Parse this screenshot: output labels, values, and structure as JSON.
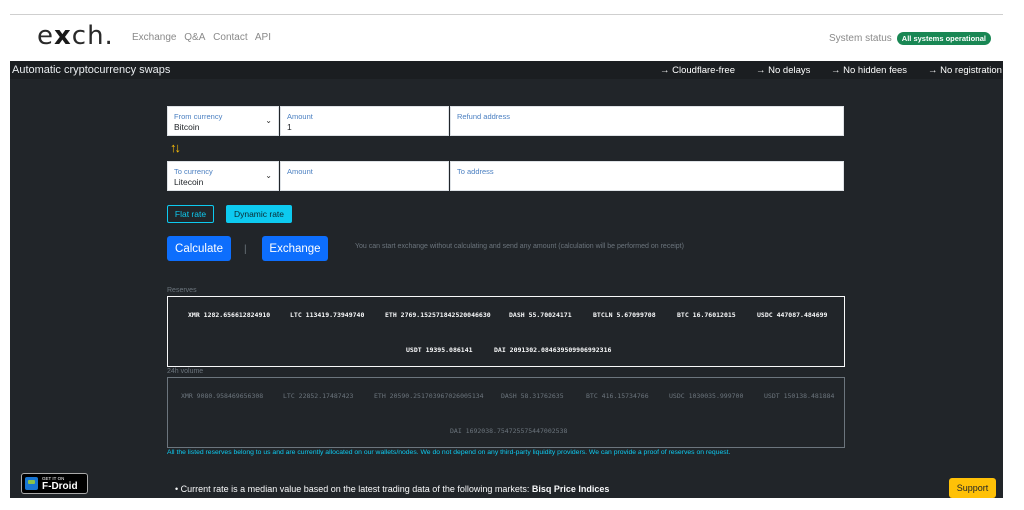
{
  "logo": {
    "prefix": "e",
    "x": "x",
    "suffix": "ch."
  },
  "nav": {
    "links": [
      "Exchange",
      "Q&A",
      "Contact",
      "API"
    ]
  },
  "system": {
    "label": "System status",
    "badge": "All systems operational"
  },
  "banner": {
    "title": "Automatic cryptocurrency swaps",
    "features": [
      "→ Cloudflare-free",
      "→ No delays",
      "→ No hidden fees",
      "→ No registration"
    ]
  },
  "form": {
    "from": {
      "label": "From currency",
      "value": "Bitcoin"
    },
    "amount1": {
      "label": "Amount",
      "value": "1"
    },
    "refund": {
      "label": "Refund address",
      "value": ""
    },
    "swap_icon": "↑↓",
    "to": {
      "label": "To currency",
      "value": "Litecoin"
    },
    "amount2": {
      "label": "Amount",
      "value": ""
    },
    "to_address": {
      "label": "To address",
      "value": ""
    },
    "flat_rate": "Flat rate",
    "dynamic_rate": "Dynamic rate",
    "calculate": "Calculate",
    "separator": "|",
    "exchange": "Exchange",
    "hint": "You can start exchange without calculating and send any amount (calculation will be performed on receipt)"
  },
  "reserves": {
    "label": "Reserves",
    "items": [
      "XMR 1282.656612824910",
      "LTC 113419.73949740",
      "ETH 2769.152571842520046630",
      "DASH 55.70024171",
      "BTCLN 5.67099708",
      "BTC 16.76012015",
      "USDC 447087.484699",
      "USDT 19395.086141",
      "DAI 2091302.084639509906992316"
    ]
  },
  "volume": {
    "label": "24h volume",
    "items": [
      "XMR 9080.958469656308",
      "LTC 22852.17487423",
      "ETH 20590.251703967026005134",
      "DASH 58.31762635",
      "BTC 416.15734766",
      "USDC 1030035.999700",
      "USDT 150138.481884",
      "DAI 1692038.754725575447002538"
    ]
  },
  "note": "All the listed reserves belong to us and are currently allocated on our wallets/nodes. We do not depend on any third-party liquidity providers. We can provide a proof of reserves on request.",
  "fdroid": {
    "small": "GET IT ON",
    "big": "F-Droid"
  },
  "footer": {
    "bullet_text": "Current rate is a median value based on the latest trading data of the following markets: ",
    "bullet_bold": "Bisq Price Indices"
  },
  "support": "Support"
}
